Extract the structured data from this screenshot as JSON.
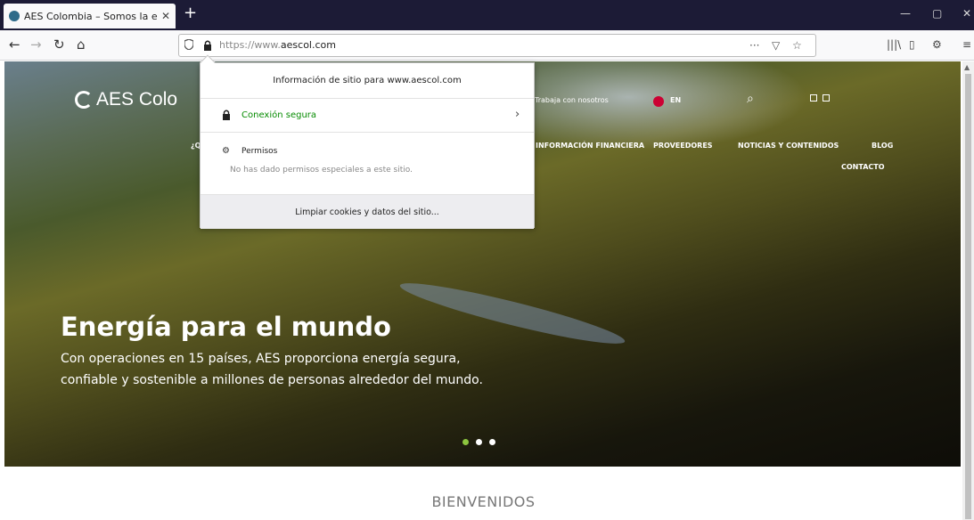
{
  "browser": {
    "tab_title": "AES Colombia – Somos la ene",
    "tab_close": "✕",
    "new_tab": "+",
    "minimize": "—",
    "maximize": "▢",
    "close": "✕",
    "back": "←",
    "forward": "→",
    "reload": "↻",
    "home": "⌂",
    "url_prefix": "https://www.",
    "url_domain": "aescol.com",
    "url_more": "···",
    "pocket": "▽",
    "bookmark": "☆",
    "library": "|||\\",
    "sidebar": "▯",
    "extension": "⚙",
    "menu": "≡"
  },
  "site_popup": {
    "title": "Información de sitio para www.aescol.com",
    "secure_label": "Conexión segura",
    "chevron": "›",
    "permissions_title": "Permisos",
    "permissions_desc": "No has dado permisos especiales a este sitio.",
    "clear_button": "Limpiar cookies y datos del sitio..."
  },
  "site": {
    "logo_text": "AES Colo",
    "work_with_us": "Trabaja con nosotros",
    "lang": "EN",
    "search_icon": "⌕",
    "menu_fragment": "¿Q",
    "menu": [
      "INFORMACIÓN FINANCIERA",
      "PROVEEDORES",
      "NOTICIAS Y CONTENIDOS",
      "BLOG",
      "CONTACTO"
    ],
    "hero_title": "Energía para el mundo",
    "hero_line1": "Con operaciones en 15 países, AES proporciona energía segura,",
    "hero_line2": "confiable y sostenible a millones de personas alrededor del mundo.",
    "welcome": "BIENVENIDOS",
    "slider_active": 1,
    "slider_count": 3
  },
  "colors": {
    "secure_green": "#058b00",
    "accent_green": "#8dc63f",
    "tabbar": "#1c1b36"
  }
}
